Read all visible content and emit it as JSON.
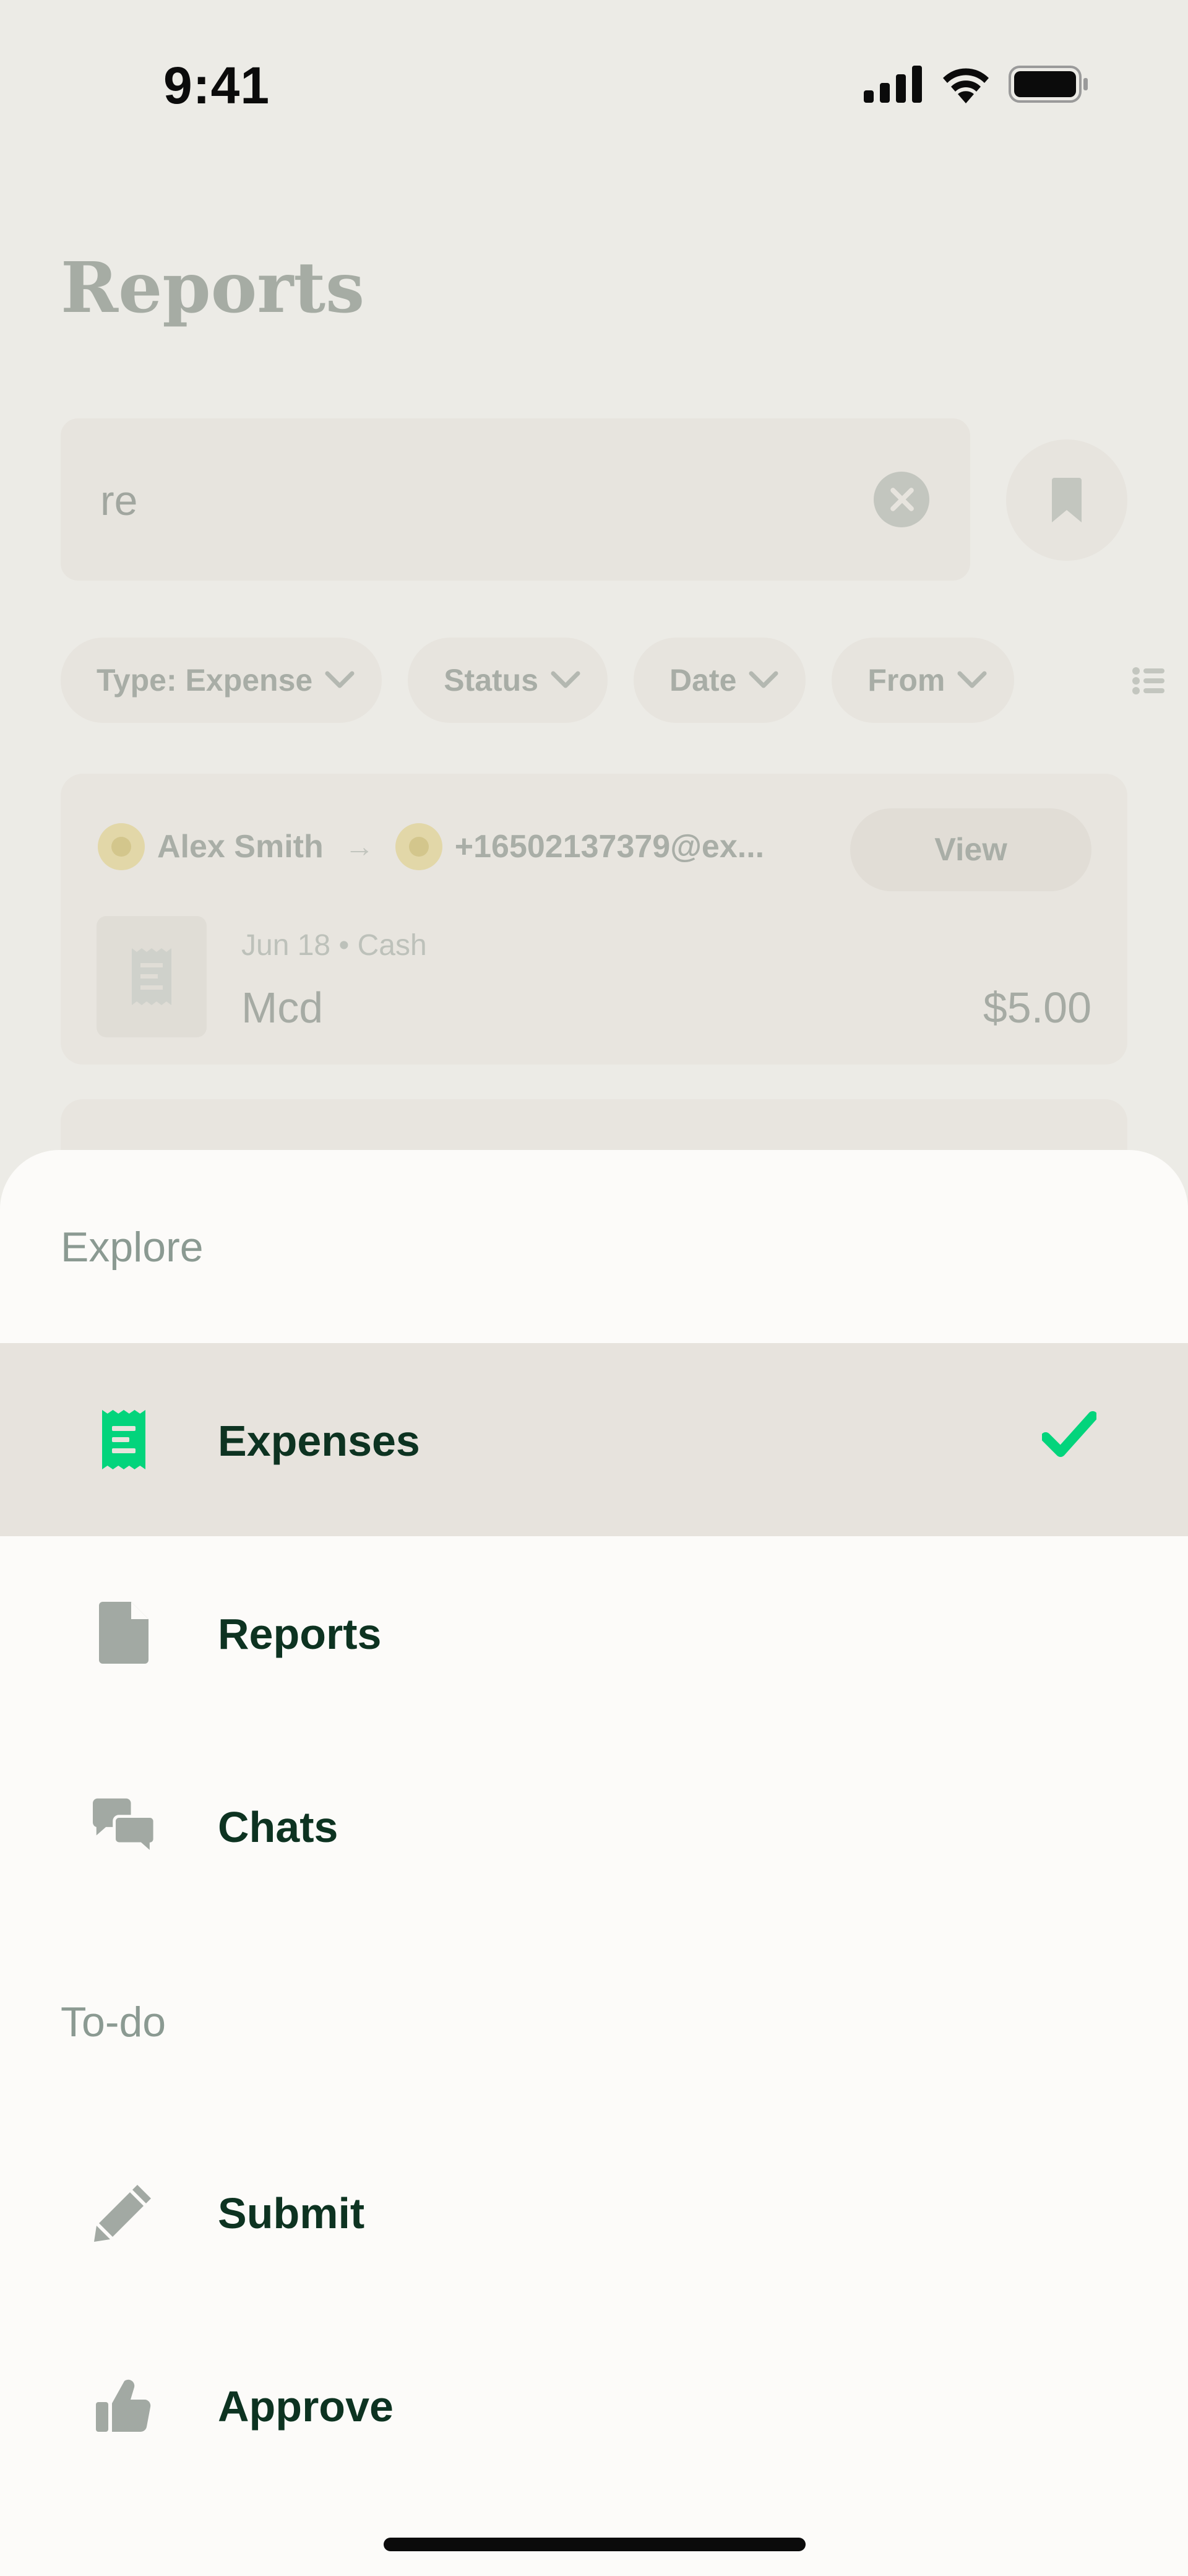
{
  "status_bar": {
    "time": "9:41"
  },
  "background": {
    "title": "Reports",
    "search": {
      "value": "re"
    },
    "filters": [
      {
        "label": "Type: Expense"
      },
      {
        "label": "Status"
      },
      {
        "label": "Date"
      },
      {
        "label": "From"
      }
    ],
    "expense_card": {
      "from": "Alex Smith",
      "to": "+16502137379@ex...",
      "view_label": "View",
      "meta": "Jun 18 • Cash",
      "merchant": "Mcd",
      "amount": "$5.00"
    }
  },
  "sheet": {
    "explore_label": "Explore",
    "explore_items": [
      {
        "label": "Expenses",
        "icon": "receipt-icon",
        "selected": true
      },
      {
        "label": "Reports",
        "icon": "document-icon",
        "selected": false
      },
      {
        "label": "Chats",
        "icon": "chat-bubbles-icon",
        "selected": false
      }
    ],
    "todo_label": "To-do",
    "todo_items": [
      {
        "label": "Submit",
        "icon": "pencil-icon"
      },
      {
        "label": "Approve",
        "icon": "thumbs-up-icon"
      }
    ]
  },
  "colors": {
    "accent_green": "#03d47c",
    "text_dark": "#0d3321",
    "icon_gray": "#a2a9a3",
    "selected_row": "#e7e3dd"
  }
}
